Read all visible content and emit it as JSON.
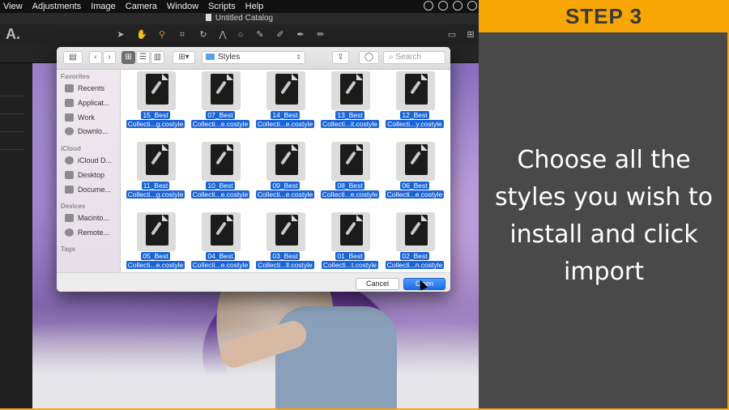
{
  "menubar": {
    "items": [
      "View",
      "Adjustments",
      "Image",
      "Camera",
      "Window",
      "Scripts",
      "Help"
    ]
  },
  "window": {
    "title": "Untitled Catalog"
  },
  "app_toolbar": {
    "logo": "A."
  },
  "dialog": {
    "path": "Styles",
    "search_placeholder": "Search",
    "sidebar": {
      "favorites_header": "Favorites",
      "favorites": [
        "Recents",
        "Applicat...",
        "Work",
        "Downlo..."
      ],
      "icloud_header": "iCloud",
      "icloud": [
        "iCloud D...",
        "Desktop",
        "Docume..."
      ],
      "devices_header": "Devices",
      "devices": [
        "Macinto...",
        "Remote..."
      ],
      "tags_header": "Tags"
    },
    "files": [
      {
        "name1": "15_Best",
        "name2": "Collecti...g.costyle"
      },
      {
        "name1": "07_Best",
        "name2": "Collecti...e.costyle"
      },
      {
        "name1": "14_Best",
        "name2": "Collecti...e.costyle"
      },
      {
        "name1": "13_Best",
        "name2": "Collecti...it.costyle"
      },
      {
        "name1": "12_Best",
        "name2": "Collecti...y.costyle"
      },
      {
        "name1": "11_Best",
        "name2": "Collecti...g.costyle"
      },
      {
        "name1": "10_Best",
        "name2": "Collecti...e.costyle"
      },
      {
        "name1": "09_Best",
        "name2": "Collecti...e.costyle"
      },
      {
        "name1": "08_Best",
        "name2": "Collecti...e.costyle"
      },
      {
        "name1": "06_Best",
        "name2": "Collecti...e.costyle"
      },
      {
        "name1": "05_Best",
        "name2": "Collecti...e.costyle"
      },
      {
        "name1": "04_Best",
        "name2": "Collecti...e.costyle"
      },
      {
        "name1": "03_Best",
        "name2": "Collecti...ll.costyle"
      },
      {
        "name1": "01_Best",
        "name2": "Collecti...t.costyle"
      },
      {
        "name1": "02_Best",
        "name2": "Collecti...n.costyle"
      }
    ],
    "cancel_label": "Cancel",
    "open_label": "Open"
  },
  "tutorial": {
    "step_label": "STEP 3",
    "instruction": "Choose all the styles you wish to install and click import",
    "accent": "#f7a603",
    "panel_bg": "#494949"
  }
}
